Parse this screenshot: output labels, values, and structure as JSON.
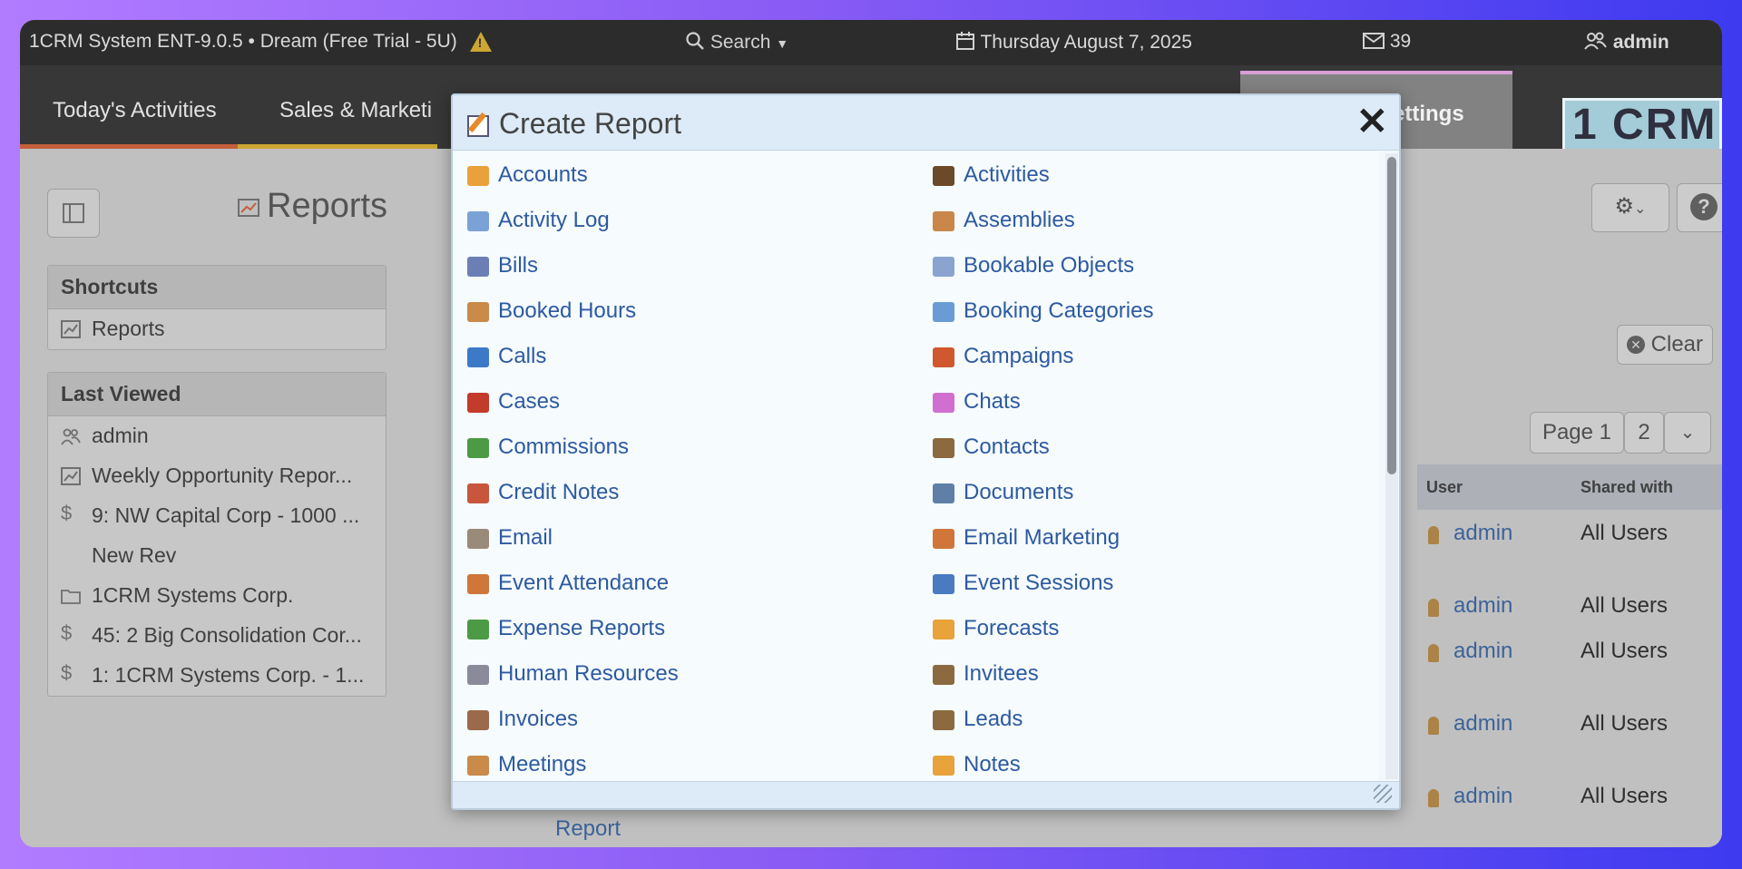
{
  "topbar": {
    "system_title": "1CRM System ENT-9.0.5 • Dream (Free Trial - 5U)",
    "search_label": "Search",
    "date": "Thursday August 7, 2025",
    "mail_count": "39",
    "user": "admin"
  },
  "nav": {
    "tabs": [
      "Today's Activities",
      "Sales & Marketi",
      "Settings"
    ],
    "logo_text": "1 CRM"
  },
  "page": {
    "title": "Reports"
  },
  "shortcuts": {
    "heading": "Shortcuts",
    "items": [
      {
        "label": "Reports",
        "icon": "report-icon"
      }
    ]
  },
  "last_viewed": {
    "heading": "Last Viewed",
    "items": [
      {
        "label": "admin",
        "icon": "users-icon"
      },
      {
        "label": "Weekly Opportunity Repor...",
        "icon": "report-icon"
      },
      {
        "label": "9: NW Capital Corp - 1000 ...",
        "icon": "dollar-icon"
      },
      {
        "label": "New Rev",
        "icon": ""
      },
      {
        "label": "1CRM Systems Corp.",
        "icon": "folder-icon"
      },
      {
        "label": "45: 2 Big Consolidation Cor...",
        "icon": "dollar-icon"
      },
      {
        "label": "1: 1CRM Systems Corp. - 1...",
        "icon": "dollar-icon"
      }
    ]
  },
  "toolbar": {
    "clear_label": "Clear",
    "page_label": "Page 1",
    "page2_label": "2"
  },
  "table": {
    "headers": {
      "user": "User",
      "shared": "Shared with"
    },
    "rows": [
      {
        "user": "admin",
        "shared": "All Users"
      },
      {
        "user": "admin",
        "shared": "All Users"
      },
      {
        "user": "admin",
        "shared": "All Users"
      },
      {
        "user": "admin",
        "shared": "All Users"
      },
      {
        "user": "admin",
        "shared": "All Users"
      }
    ],
    "below_label": "Report"
  },
  "modal": {
    "title": "Create Report",
    "items": [
      {
        "label": "Accounts",
        "color": "#e9a23b"
      },
      {
        "label": "Activities",
        "color": "#6b4a2a"
      },
      {
        "label": "Activity Log",
        "color": "#7aa2d6"
      },
      {
        "label": "Assemblies",
        "color": "#c9874a"
      },
      {
        "label": "Bills",
        "color": "#6c7fb4"
      },
      {
        "label": "Bookable Objects",
        "color": "#8aa4cf"
      },
      {
        "label": "Booked Hours",
        "color": "#c98a4a"
      },
      {
        "label": "Booking Categories",
        "color": "#6a9bd6"
      },
      {
        "label": "Calls",
        "color": "#3c7ac8"
      },
      {
        "label": "Campaigns",
        "color": "#d0582f"
      },
      {
        "label": "Cases",
        "color": "#c23b2b"
      },
      {
        "label": "Chats",
        "color": "#d06fd0"
      },
      {
        "label": "Commissions",
        "color": "#4c9a46"
      },
      {
        "label": "Contacts",
        "color": "#8a6a3e"
      },
      {
        "label": "Credit Notes",
        "color": "#c8563c"
      },
      {
        "label": "Documents",
        "color": "#5f7fa6"
      },
      {
        "label": "Email",
        "color": "#9a8a7a"
      },
      {
        "label": "Email Marketing",
        "color": "#d0763a"
      },
      {
        "label": "Event Attendance",
        "color": "#d0763a"
      },
      {
        "label": "Event Sessions",
        "color": "#4a7ac0"
      },
      {
        "label": "Expense Reports",
        "color": "#4c9a46"
      },
      {
        "label": "Forecasts",
        "color": "#e8a33a"
      },
      {
        "label": "Human Resources",
        "color": "#8a8a9a"
      },
      {
        "label": "Invitees",
        "color": "#8a6a3e"
      },
      {
        "label": "Invoices",
        "color": "#9a6a4a"
      },
      {
        "label": "Leads",
        "color": "#8a6a3e"
      },
      {
        "label": "Meetings",
        "color": "#c98a4a"
      },
      {
        "label": "Notes",
        "color": "#e8a33a"
      }
    ]
  }
}
